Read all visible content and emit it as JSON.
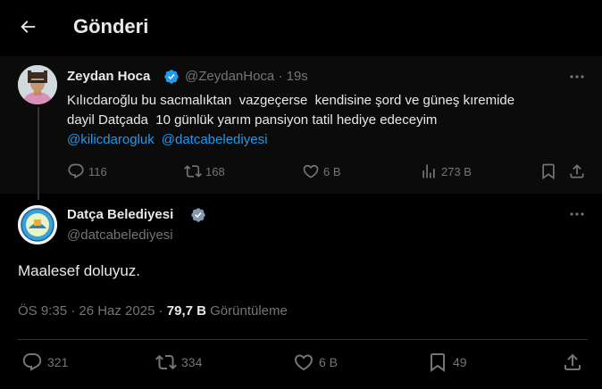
{
  "header": {
    "title": "Gönderi",
    "back_icon": "arrow-left-icon"
  },
  "colors": {
    "background": "#000000",
    "link": "#1d9bf0",
    "muted": "#71767b",
    "verified": "#1d9bf0"
  },
  "parent_tweet": {
    "name": "Zeydan Hoca",
    "handle_time": "@ZeydanHoca · 19s",
    "text_line1": "Kılıcdaroğlu bu sacmalıktan  vazgeçerse  kendisine şord ve güneş kıremide",
    "text_line2": "dayil Datçada  10 günlük yarım pansiyon tatil hediye edeceyim",
    "mentions": [
      "@kilicdarogluk",
      "@datcabelediyesi"
    ],
    "actions": {
      "reply": "116",
      "retweet": "168",
      "like": "6 B",
      "views": "273 B"
    }
  },
  "main_tweet": {
    "name": "Datça Belediyesi",
    "handle": "@datcabelediyesi",
    "text": "Maalesef doluyuz.",
    "meta_time": "ÖS 9:35 · 26 Haz 2025 · ",
    "meta_views_count": "79,7 B",
    "meta_views_label": " Görüntüleme",
    "actions": {
      "reply": "321",
      "retweet": "334",
      "like": "6 B",
      "bookmark": "49"
    }
  }
}
